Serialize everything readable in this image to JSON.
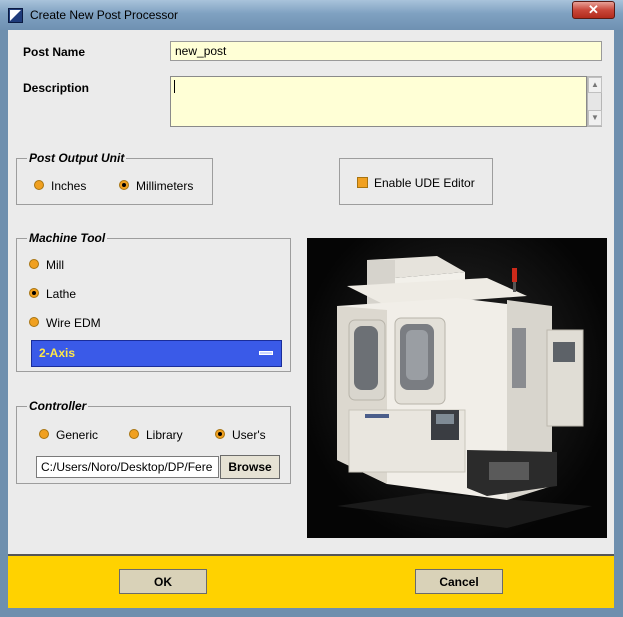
{
  "window": {
    "title": "Create New Post Processor",
    "close_glyph": "✕"
  },
  "post_name": {
    "label": "Post Name",
    "value": "new_post"
  },
  "description": {
    "label": "Description",
    "value": ""
  },
  "output_unit": {
    "legend": "Post Output Unit",
    "options": [
      {
        "label": "Inches",
        "selected": false
      },
      {
        "label": "Millimeters",
        "selected": true
      }
    ]
  },
  "ude": {
    "label": "Enable UDE Editor",
    "checked": false
  },
  "machine_tool": {
    "legend": "Machine Tool",
    "options": [
      {
        "label": "Mill",
        "selected": false
      },
      {
        "label": "Lathe",
        "selected": true
      },
      {
        "label": "Wire EDM",
        "selected": false
      }
    ],
    "axis_value": "2-Axis"
  },
  "controller": {
    "legend": "Controller",
    "options": [
      {
        "label": "Generic",
        "selected": false
      },
      {
        "label": "Library",
        "selected": false
      },
      {
        "label": "User's",
        "selected": true
      }
    ],
    "path_value": "C:/Users/Noro/Desktop/DP/Fere",
    "browse_label": "Browse"
  },
  "footer": {
    "ok_label": "OK",
    "cancel_label": "Cancel"
  },
  "colors": {
    "field_bg": "#ffffd6",
    "radio": "#f0a020",
    "axis_select_bg": "#3a5ae8",
    "axis_select_text": "#ffe84a",
    "footer_bg": "#ffd200"
  },
  "icons": {
    "app": "app-icon",
    "close": "close-icon",
    "scroll_up": "scroll-up-icon",
    "scroll_down": "scroll-down-icon",
    "option_menu": "option-menu-icon"
  }
}
